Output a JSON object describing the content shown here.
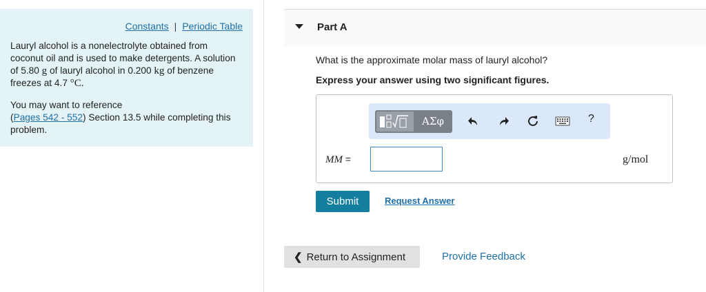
{
  "sidebar": {
    "links": {
      "constants": "Constants",
      "separator": "|",
      "periodic_table": "Periodic Table"
    },
    "problem": {
      "part1": "Lauryl alcohol is a nonelectrolyte obtained from coconut oil and is used to make detergents. A solution of 5.80 ",
      "unit_g": "g",
      "part2": " of lauryl alcohol in 0.200 ",
      "unit_kg": "kg",
      "part3": " of benzene freezes at 4.7 ",
      "temp_unit": "°C."
    },
    "reference": {
      "prefix": "You may want to reference",
      "open_paren": "(",
      "pages_link": "Pages 542 - 552",
      "suffix": ") Section 13.5 while completing this problem."
    }
  },
  "part": {
    "title": "Part A"
  },
  "question": {
    "text": "What is the approximate molar mass of lauryl alcohol?",
    "instruction": "Express your answer using two significant figures."
  },
  "toolbar": {
    "greek_label": "ΑΣφ",
    "help_label": "?",
    "icons": [
      "templates-icon",
      "greek-letters-icon",
      "undo-icon",
      "redo-icon",
      "reset-icon",
      "keyboard-icon",
      "help-icon"
    ]
  },
  "answer": {
    "var_label": "MM",
    "equals": " =",
    "value": "",
    "unit": "g/mol"
  },
  "actions": {
    "submit": "Submit",
    "request_answer": "Request Answer",
    "return": "Return to Assignment",
    "feedback": "Provide Feedback"
  },
  "colors": {
    "panel_bg": "#e3f3f6",
    "link": "#1f6fa8",
    "submit_bg": "#137e9e",
    "toolbar_bg": "#dbe8fb",
    "input_border": "#3d86c6"
  }
}
